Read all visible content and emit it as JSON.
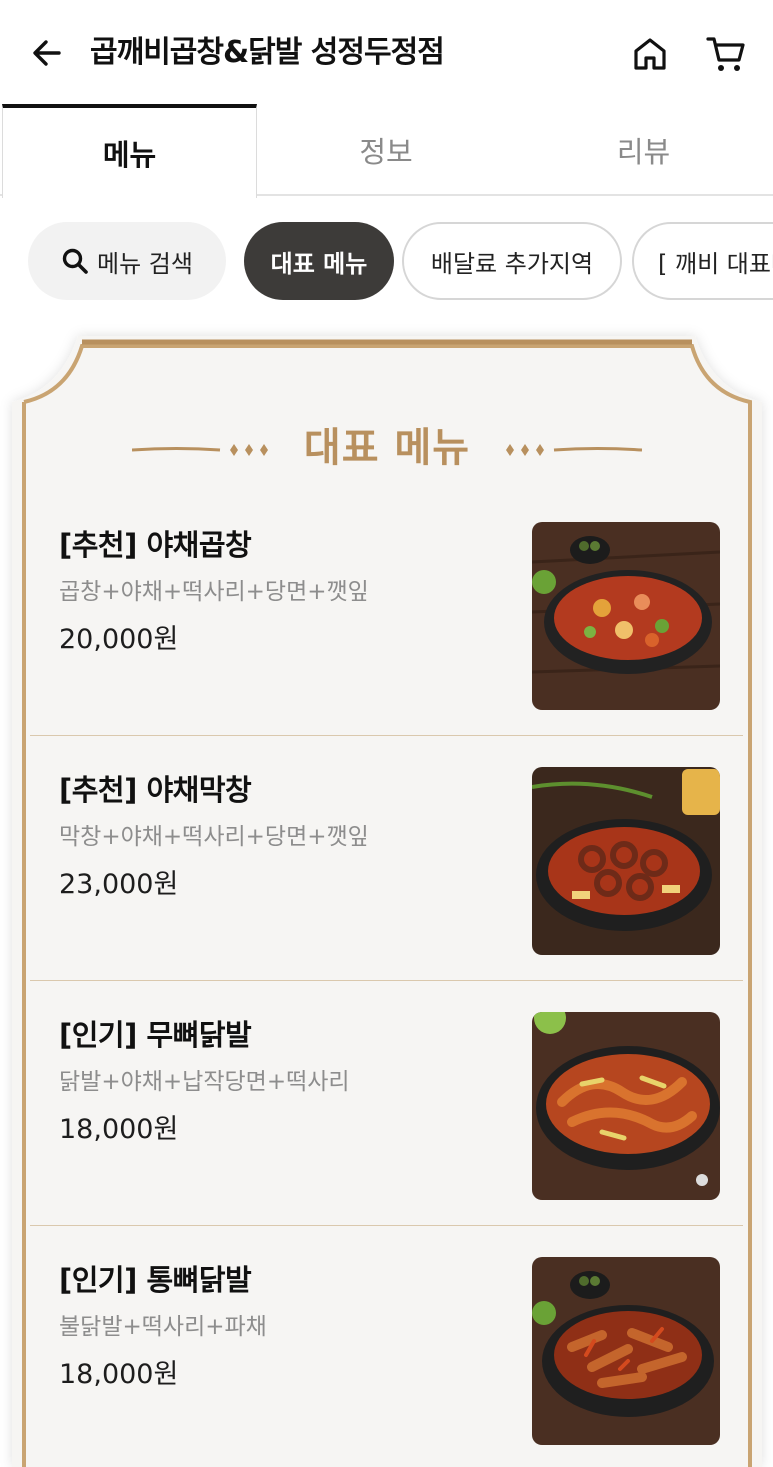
{
  "header": {
    "store_name": "곱깨비곱창&닭발 성정두정점",
    "back_icon": "arrow-left-icon",
    "home_icon": "home-icon",
    "cart_icon": "cart-icon"
  },
  "tabs": [
    {
      "label": "메뉴",
      "active": true
    },
    {
      "label": "정보",
      "active": false
    },
    {
      "label": "리뷰",
      "active": false
    }
  ],
  "chips": {
    "search_label": "메뉴 검색",
    "items": [
      {
        "label": "대표 메뉴",
        "active": true
      },
      {
        "label": "배달료 추가지역",
        "active": false
      },
      {
        "label": "[ 깨비 대표메뉴",
        "active": false
      }
    ]
  },
  "section": {
    "title": "대표 메뉴"
  },
  "menu_items": [
    {
      "name": "[추천] 야채곱창",
      "desc": "곱창+야채+떡사리+당면+깻잎",
      "price": "20,000원"
    },
    {
      "name": "[추천] 야채막창",
      "desc": "막창+야채+떡사리+당면+깻잎",
      "price": "23,000원"
    },
    {
      "name": "[인기] 무뼈닭발",
      "desc": "닭발+야채+납작당면+떡사리",
      "price": "18,000원"
    },
    {
      "name": "[인기] 통뼈닭발",
      "desc": "불닭발+떡사리+파채",
      "price": "18,000원"
    }
  ],
  "colors": {
    "accent_gold": "#b8905e",
    "board_bg": "#f6f5f3",
    "chip_active": "#3d3b39"
  }
}
